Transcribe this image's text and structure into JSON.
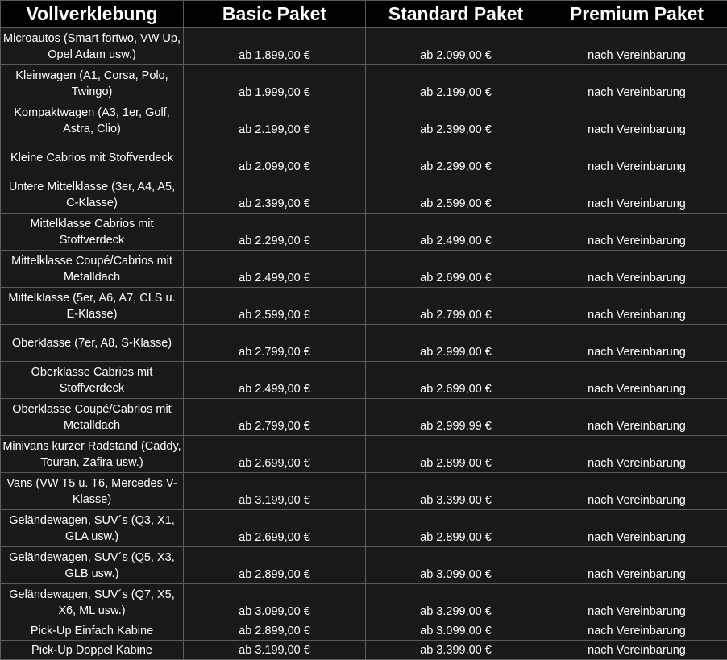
{
  "table": {
    "headers": [
      "Vollverklebung",
      "Basic Paket",
      "Standard Paket",
      "Premium Paket"
    ],
    "rows": [
      {
        "category": "Microautos (Smart fortwo, VW Up, Opel Adam usw.)",
        "basic": "ab 1.899,00 €",
        "standard": "ab 2.099,00 €",
        "premium": "nach Vereinbarung"
      },
      {
        "category": "Kleinwagen (A1, Corsa, Polo, Twingo)",
        "basic": "ab 1.999,00 €",
        "standard": "ab 2.199,00 €",
        "premium": "nach Vereinbarung"
      },
      {
        "category": "Kompaktwagen (A3, 1er, Golf, Astra, Clio)",
        "basic": "ab 2.199,00 €",
        "standard": "ab 2.399,00 €",
        "premium": "nach Vereinbarung"
      },
      {
        "category": "Kleine Cabrios mit Stoffverdeck",
        "basic": "ab 2.099,00 €",
        "standard": "ab 2.299,00 €",
        "premium": "nach Vereinbarung"
      },
      {
        "category": "Untere Mittelklasse (3er, A4, A5, C-Klasse)",
        "basic": "ab 2.399,00 €",
        "standard": "ab 2.599,00 €",
        "premium": "nach Vereinbarung"
      },
      {
        "category": "Mittelklasse Cabrios mit Stoffverdeck",
        "basic": "ab 2.299,00 €",
        "standard": "ab 2.499,00 €",
        "premium": "nach Vereinbarung"
      },
      {
        "category": "Mittelklasse Coupé/Cabrios mit Metalldach",
        "basic": "ab 2.499,00 €",
        "standard": "ab 2.699,00 €",
        "premium": "nach Vereinbarung"
      },
      {
        "category": "Mittelklasse (5er, A6, A7, CLS u. E-Klasse)",
        "basic": "ab 2.599,00 €",
        "standard": "ab 2.799,00 €",
        "premium": "nach Vereinbarung"
      },
      {
        "category": "Oberklasse (7er, A8, S-Klasse)",
        "basic": "ab 2.799,00 €",
        "standard": "ab 2.999,00 €",
        "premium": "nach Vereinbarung"
      },
      {
        "category": "Oberklasse Cabrios mit Stoffverdeck",
        "basic": "ab 2.499,00 €",
        "standard": "ab 2.699,00 €",
        "premium": "nach Vereinbarung"
      },
      {
        "category": "Oberklasse Coupé/Cabrios mit Metalldach",
        "basic": "ab 2.799,00 €",
        "standard": "ab 2.999,99 €",
        "premium": "nach Vereinbarung"
      },
      {
        "category": "Minivans kurzer Radstand (Caddy, Touran, Zafira usw.)",
        "basic": "ab 2.699,00 €",
        "standard": "ab 2.899,00 €",
        "premium": "nach Vereinbarung"
      },
      {
        "category": "Vans (VW T5 u. T6, Mercedes V-Klasse)",
        "basic": "ab 3.199,00 €",
        "standard": "ab 3.399,00 €",
        "premium": "nach Vereinbarung"
      },
      {
        "category": "Geländewagen, SUV´s (Q3, X1, GLA usw.)",
        "basic": "ab 2.699,00 €",
        "standard": "ab 2.899,00 €",
        "premium": "nach Vereinbarung"
      },
      {
        "category": "Geländewagen, SUV´s (Q5, X3, GLB usw.)",
        "basic": "ab 2.899,00 €",
        "standard": "ab 3.099,00 €",
        "premium": "nach Vereinbarung"
      },
      {
        "category": "Geländewagen, SUV´s (Q7, X5, X6, ML usw.)",
        "basic": "ab 3.099,00 €",
        "standard": "ab 3.299,00 €",
        "premium": "nach Vereinbarung"
      },
      {
        "category": "Pick-Up Einfach Kabine",
        "basic": "ab 2.899,00 €",
        "standard": "ab 3.099,00 €",
        "premium": "nach Vereinbarung"
      },
      {
        "category": "Pick-Up Doppel Kabine",
        "basic": "ab 3.199,00 €",
        "standard": "ab 3.399,00 €",
        "premium": "nach Vereinbarung"
      }
    ]
  }
}
